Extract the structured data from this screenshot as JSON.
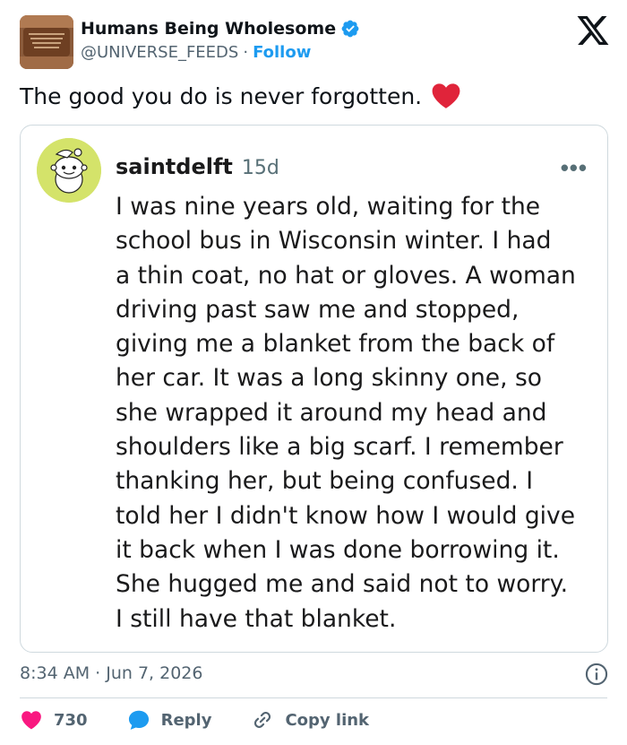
{
  "author": {
    "display_name": "Humans Being Wholesome",
    "handle": "@UNIVERSE_FEEDS",
    "separator": "·",
    "follow_label": "Follow",
    "verified": true,
    "avatar_icon": "wood-plaque-avatar"
  },
  "tweet": {
    "text": "The good you do is never forgotten.",
    "emoji": "red-heart"
  },
  "embedded_post": {
    "username": "saintdelft",
    "age": "15d",
    "more_label": "•••",
    "lines": [
      "I was nine years old, waiting for the",
      "school bus in Wisconsin winter. I had",
      "a thin coat, no hat or gloves. A woman",
      "driving past saw me and stopped,",
      "giving me a blanket from the back of",
      "her car. It was a long skinny one, so",
      "she wrapped it around my head and",
      "shoulders like a big scarf. I remember",
      "thanking her, but being confused. I",
      "told her I didn't know how I would give",
      "it back when I was done borrowing it.",
      "She hugged me and said not to worry.",
      "I still have that blanket."
    ]
  },
  "footer": {
    "timestamp": "8:34 AM · Jun 7, 2026",
    "likes": "730",
    "reply_label": "Reply",
    "copy_link_label": "Copy link"
  },
  "colors": {
    "accent": "#1d9bf0",
    "like": "#f91880",
    "text": "#0f1419",
    "muted": "#536471"
  }
}
